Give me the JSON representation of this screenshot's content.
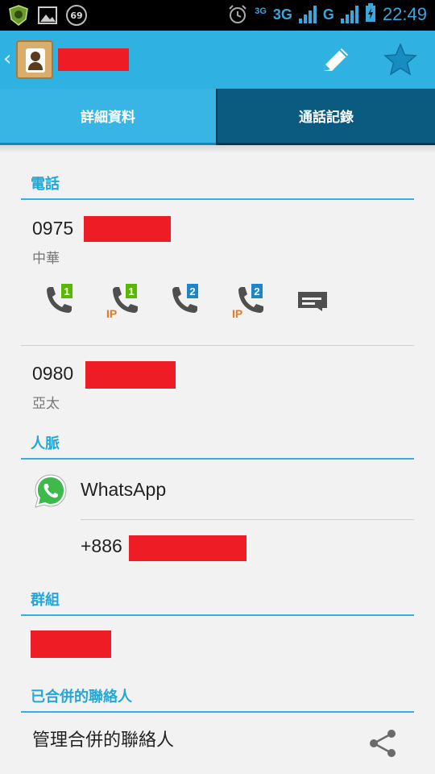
{
  "status_bar": {
    "battery_badge": "69",
    "net_1": "3G",
    "net_2": "3G",
    "net_3": "G",
    "time": "22:49",
    "icons": [
      "app-shield-icon",
      "image-icon",
      "alarm-icon",
      "signal-icon",
      "battery-charging-icon"
    ]
  },
  "action_bar": {
    "back_icon": "chevron-left-icon",
    "app_icon": "contacts-icon",
    "edit_icon": "pencil-icon",
    "star_icon": "star-icon",
    "accent": "#2fb1e2"
  },
  "tabs": [
    {
      "label": "詳細資料",
      "selected": true
    },
    {
      "label": "通話記錄",
      "selected": false
    }
  ],
  "sections": {
    "phone": "電話",
    "connections": "人脈",
    "groups": "群組",
    "merged": "已合併的聯絡人"
  },
  "phones": [
    {
      "number": "0975",
      "type": "中華"
    },
    {
      "number": "0980",
      "type": "亞太"
    }
  ],
  "call_actions": [
    {
      "icon": "call-sim1-icon",
      "label": "1"
    },
    {
      "icon": "ip-call-sim1-icon",
      "label": "1",
      "prefix": "IP"
    },
    {
      "icon": "call-sim2-icon",
      "label": "2"
    },
    {
      "icon": "ip-call-sim2-icon",
      "label": "2",
      "prefix": "IP"
    },
    {
      "icon": "message-icon"
    }
  ],
  "whatsapp": {
    "name": "WhatsApp",
    "number": "+886"
  },
  "merged": {
    "manage_label": "管理合併的聯絡人"
  }
}
